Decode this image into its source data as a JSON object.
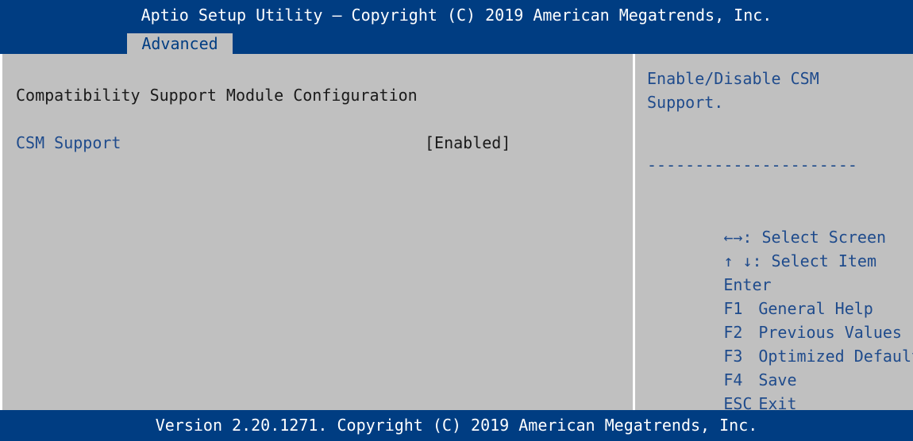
{
  "header": {
    "title": "Aptio Setup Utility – Copyright (C) 2019 American Megatrends, Inc."
  },
  "tabs": [
    {
      "label": "Advanced",
      "active": true
    }
  ],
  "main": {
    "section_title": "Compatibility Support Module Configuration",
    "settings": [
      {
        "label": "CSM Support",
        "value": "[Enabled]"
      }
    ]
  },
  "help": {
    "description": "Enable/Disable CSM\nSupport.",
    "separator": "----------------------",
    "keys": [
      {
        "key": "←→",
        "action": ": Select Screen",
        "icon": "left-right-arrows-icon"
      },
      {
        "key": "↑ ↓",
        "action": ": Select Item",
        "icon": "up-down-arrows-icon"
      },
      {
        "key": "Enter",
        "action": ""
      },
      {
        "key": "F1",
        "action": "General Help"
      },
      {
        "key": "F2",
        "action": "Previous Values"
      },
      {
        "key": "F3",
        "action": "Optimized Defaults"
      },
      {
        "key": "F4",
        "action": "Save"
      },
      {
        "key": "ESC",
        "action": "Exit"
      }
    ]
  },
  "footer": {
    "version": "Version 2.20.1271. Copyright (C) 2019 American Megatrends, Inc."
  },
  "colors": {
    "bar_blue": "#003d82",
    "panel_gray": "#c0c0c0",
    "help_text_blue": "#1f4b8c",
    "text_dark": "#1a1a1a",
    "divider_white": "#ffffff"
  }
}
